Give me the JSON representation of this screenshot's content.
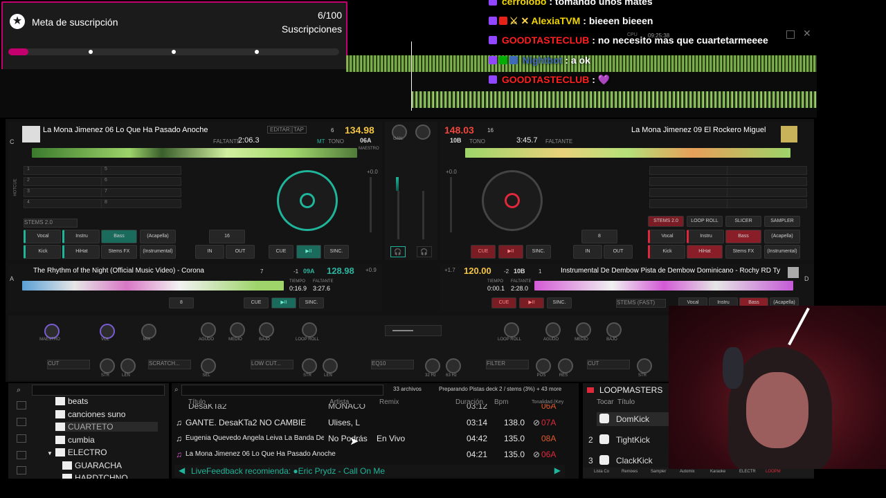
{
  "subscription_widget": {
    "title": "Meta de suscripción",
    "count": "6/100",
    "unit": "Suscripciones",
    "progress_fraction": 0.06
  },
  "chat": [
    {
      "user": "cerrolobo",
      "message": "tomando unos mates",
      "color": "#f2d600"
    },
    {
      "user": "AlexiaTVM",
      "message": "bieeen bieeen",
      "color": "#f2d600"
    },
    {
      "user": "GOODTASTECLUB",
      "message": "no necesito mas que cuartetarmeeee",
      "color": "#ff1f1f"
    },
    {
      "user": "Nightbot",
      "message": "a ok",
      "color": "#3e6ab6"
    },
    {
      "user": "GOODTASTECLUB",
      "message": "💜",
      "color": "#ff1f1f"
    }
  ],
  "topbar": {
    "clock": "09:25:38",
    "cpu_label": "CPU"
  },
  "deck_c": {
    "letter": "C",
    "title": "La Mona Jimenez 06 Lo Que Ha Pasado Anoche",
    "bpm": "134.98",
    "time_label": "FALTANTE",
    "time": "2:06.3",
    "key": "06A",
    "key_num": "6",
    "edit_label": "EDITAR",
    "tap_label": "TAP",
    "master_label": "MAESTRO",
    "sync_label": "SINC.",
    "mt_label": "MT",
    "tono_label": "TONO",
    "pitch": "+0.0",
    "stems_label": "STEMS 2.0",
    "stems": [
      "Vocal",
      "Instru",
      "Bass",
      "(Acapella)",
      "Kick",
      "HiHat",
      "Stems FX",
      "(Instrumental)"
    ],
    "loop_size": "16",
    "in_label": "IN",
    "out_label": "OUT",
    "cue_label": "CUE",
    "play_label": "▶II",
    "hotcue_label": "HOTCUE",
    "cue_numbers": [
      "1",
      "2",
      "3",
      "4",
      "5",
      "6",
      "7",
      "8"
    ]
  },
  "deck_b": {
    "title": "La Mona Jimenez 09 El Rockero Miguel",
    "bpm": "148.03",
    "key": "10B",
    "key_num": "16",
    "time_label": "FALTANTE",
    "time": "3:45.7",
    "tono_label": "TONO",
    "stems_label": "STEMS 2.0",
    "loop_roll_label": "LOOP ROLL",
    "slicer_label": "SLICER",
    "sampler_label": "SAMPLER",
    "stems": [
      "Vocal",
      "Instru",
      "Bass",
      "(Acapella)",
      "Kick",
      "HiHat",
      "Stems FX",
      "(Instrumental)"
    ],
    "loop_size": "8",
    "in_label": "IN",
    "out_label": "OUT",
    "cue_label": "CUE",
    "play_label": "▶II",
    "sync_label": "SINC.",
    "pitch": "+0.0"
  },
  "deck_a": {
    "letter": "A",
    "title": "The Rhythm of the Night (Official Music Video) - Corona",
    "bpm": "128.98",
    "key": "09A",
    "pitch_offset": "-1",
    "key_num": "7",
    "tiempo_label": "TIEMPO",
    "faltante_label": "FALTANTE",
    "tiempo": "0:16.9",
    "faltante": "3:27.6",
    "pitch": "+0.9",
    "loop_size": "8",
    "cue_label": "CUE",
    "play_label": "▶II",
    "sync_label": "SINC."
  },
  "deck_d": {
    "letter": "D",
    "title": "Instrumental De Dembow  Pista de Dembow Dominicano - Rochy RD Ty",
    "bpm": "120.00",
    "key": "10B",
    "pitch_offset": "-2",
    "key_num": "1",
    "tiempo_label": "TIEMPO",
    "faltante_label": "FALTANTE",
    "tiempo": "0:00.1",
    "faltante": "2:28.0",
    "pitch": "+1.7",
    "cue_label": "CUE",
    "play_label": "▶II",
    "sync_label": "SINC.",
    "stems_label": "STEMS (FAST)",
    "stems": [
      "Vocal",
      "Instru",
      "Bass",
      "(Acapella)"
    ]
  },
  "mixer": {
    "gain_label": "GAN.",
    "fx_left": [
      "MAESTRO",
      "VOL",
      "MIX"
    ],
    "eq_labels": [
      "AGUDO",
      "MEDIO",
      "BAJO"
    ],
    "loop_roll": "LOOP ROLL",
    "cut_label": "CUT",
    "scratch_label": "SCRATCH...",
    "lowcut_label": "LOW CUT...",
    "eq10_label": "EQ10",
    "filter_label": "FILTER",
    "knob_small": [
      "STR",
      "LEN",
      "SEL",
      "STR",
      "LEN",
      "32 Hz",
      "63 Hz",
      "POS",
      "RES",
      "STR",
      "LEN"
    ]
  },
  "browser": {
    "folders": [
      {
        "name": "beats"
      },
      {
        "name": "canciones suno"
      },
      {
        "name": "CUARTETO"
      },
      {
        "name": "cumbia"
      },
      {
        "name": "ELECTRO"
      },
      {
        "name": "GUARACHA"
      },
      {
        "name": "HARDTCHNO"
      }
    ],
    "file_count": "33 archivos",
    "status": "Preparando Pistas deck 2 / stems (3%) + 43 more",
    "columns": {
      "title": "Título",
      "artist": "Artista",
      "remix": "Remix",
      "duration": "Duración",
      "bpm": "Bpm",
      "key": "Tonalidad (Key"
    },
    "partial_row": {
      "title": "DesaKTa2",
      "artist": "MONACO",
      "duration": "03:12",
      "key": "06A"
    },
    "rows": [
      {
        "title": "GANTE. DesaKTa2   NO CAMBIE",
        "artist": "Ulises, L",
        "remix": "",
        "duration": "03:14",
        "bpm": "138.0",
        "key": "07A"
      },
      {
        "title": "Eugenia Quevedo Angela Leiva La Banda De C...",
        "artist": "No Podrás",
        "remix": "En Vivo",
        "duration": "04:42",
        "bpm": "135.0",
        "key": "08A"
      },
      {
        "title": "La Mona Jimenez 06 Lo Que Ha Pasado Anoche",
        "artist": "",
        "remix": "",
        "duration": "04:21",
        "bpm": "135.0",
        "key": "06A"
      }
    ],
    "live_feedback": "LiveFeedback recomienda: ●Eric Prydz - Call On Me"
  },
  "loopmasters": {
    "title": "LOOPMASTERS",
    "col_play": "Tocar",
    "col_title": "Título",
    "items": [
      {
        "num": "",
        "name": "DomKick"
      },
      {
        "num": "2",
        "name": "TightKick"
      },
      {
        "num": "3",
        "name": "ClackKick"
      }
    ]
  },
  "bottom_tabs": [
    "Lista Co",
    "Remixes",
    "Sampler",
    "Automix",
    "Karaoke",
    "ELECTR",
    "LOOPM"
  ],
  "colors": {
    "accent_teal": "#1fb59a",
    "accent_red": "#e0283c",
    "sub_border": "#c3006e",
    "bpm_left": "#f4c542",
    "bpm_right": "#f0473c"
  }
}
